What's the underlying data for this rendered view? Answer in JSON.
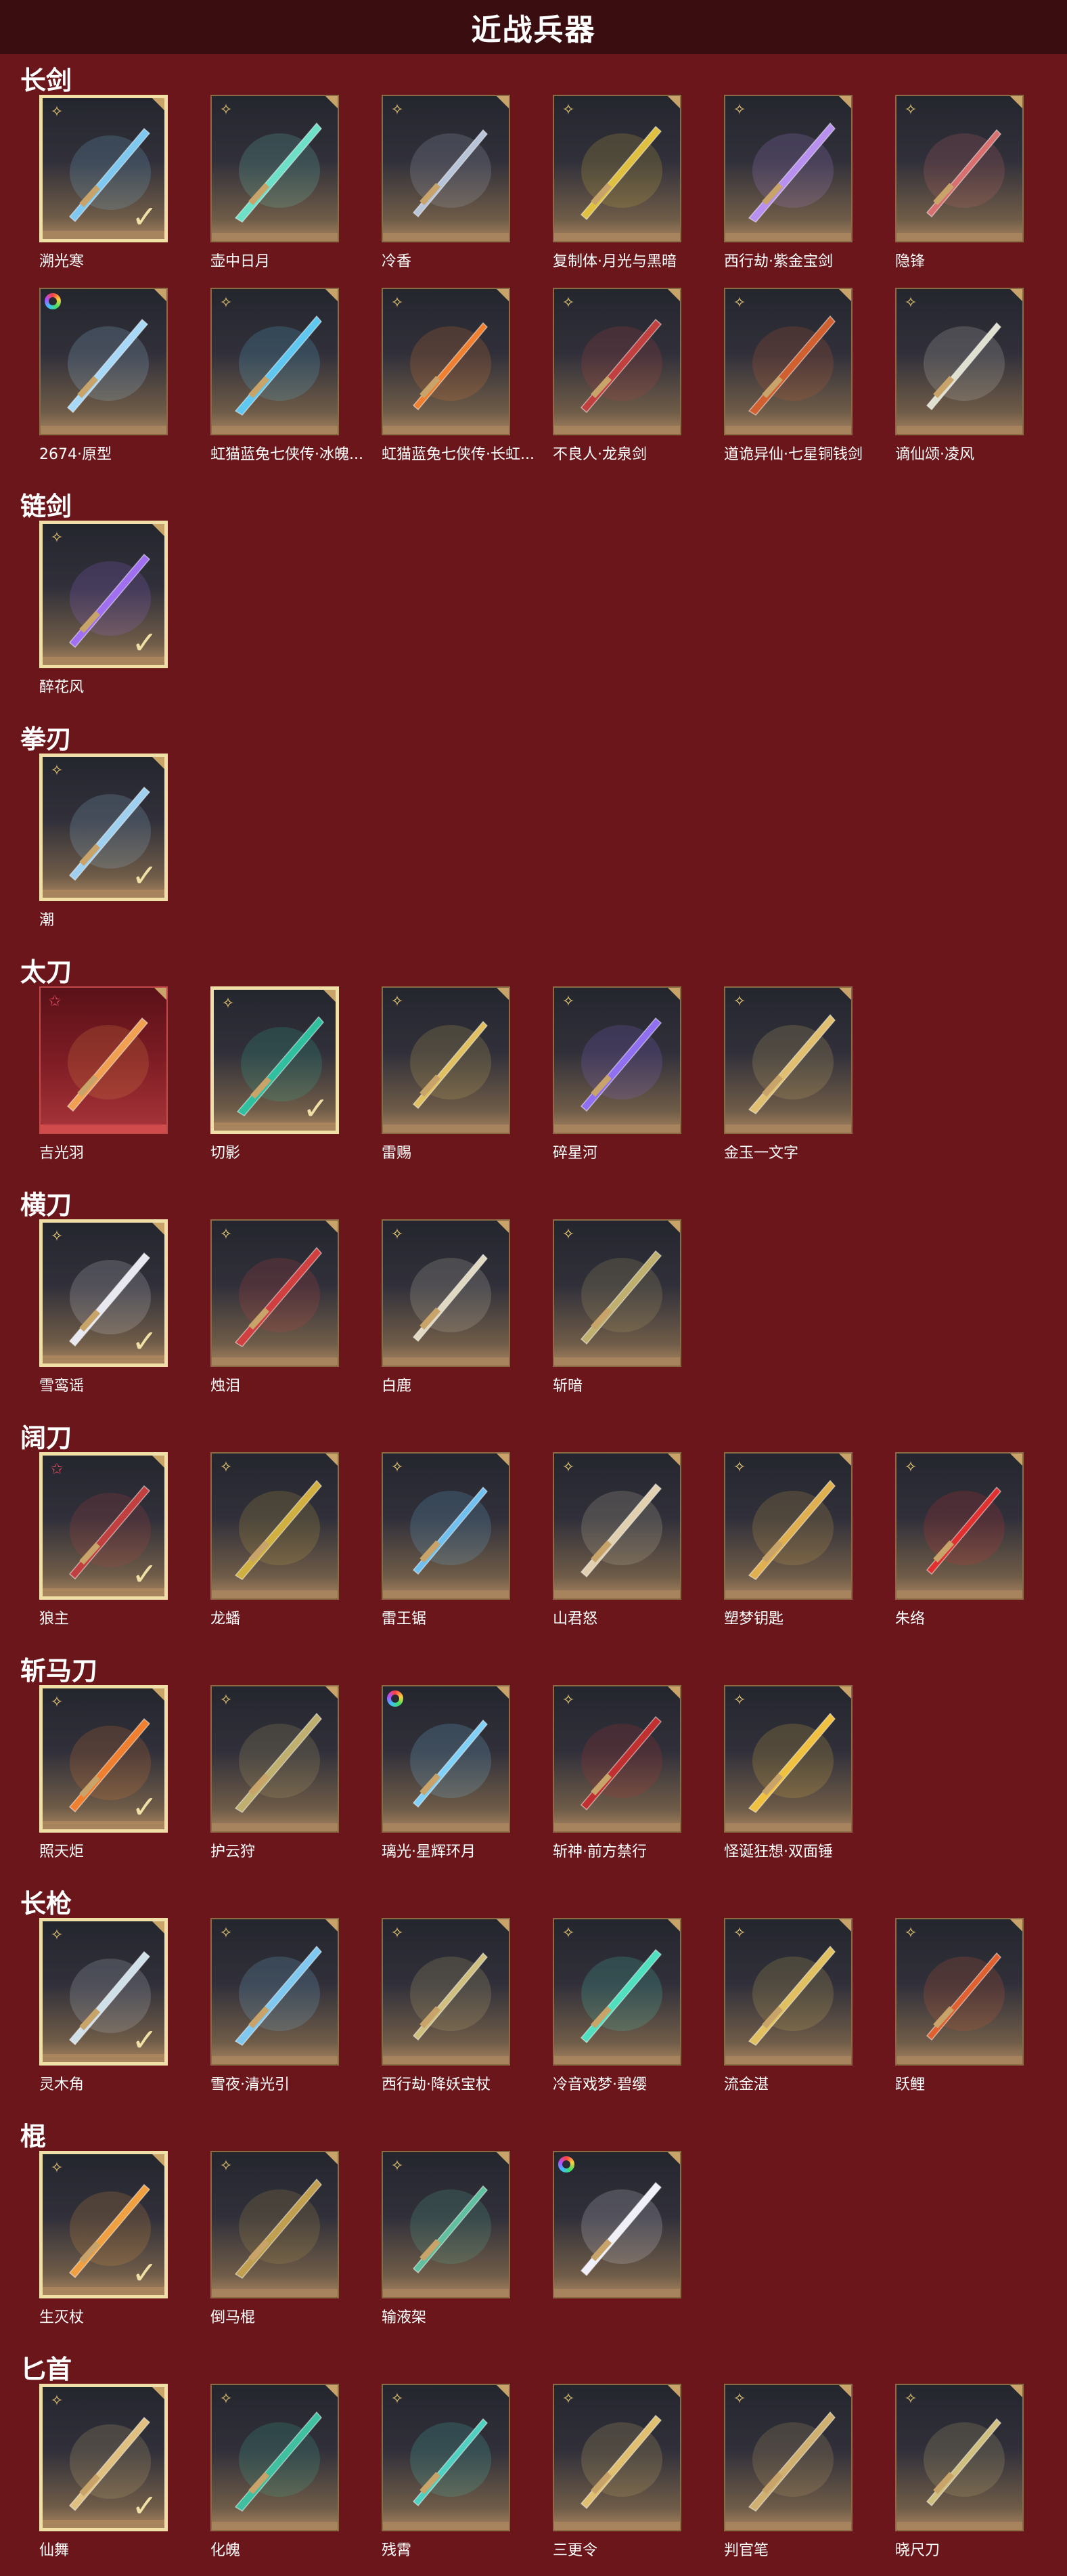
{
  "header": {
    "title": "近战兵器"
  },
  "categories": [
    {
      "title": "长剑",
      "items": [
        {
          "name": "溯光寒",
          "badge": "gold",
          "selected": true,
          "color": "#7fc8f0"
        },
        {
          "name": "壶中日月",
          "badge": "gold",
          "selected": false,
          "color": "#6fe0c8"
        },
        {
          "name": "冷香",
          "badge": "gold",
          "selected": false,
          "color": "#b8c4d8"
        },
        {
          "name": "复制体·月光与黑暗",
          "badge": "gold",
          "selected": false,
          "color": "#e0c040"
        },
        {
          "name": "西行劫·紫金宝剑",
          "badge": "gold",
          "selected": false,
          "color": "#b890f0"
        },
        {
          "name": "隐锋",
          "badge": "gold",
          "selected": false,
          "color": "#d87070"
        },
        {
          "name": "2674·原型",
          "badge": "rainbow",
          "selected": false,
          "color": "#a8d8f8"
        },
        {
          "name": "虹猫蓝兔七侠传·冰魄...",
          "badge": "gold",
          "selected": false,
          "color": "#60c8f0"
        },
        {
          "name": "虹猫蓝兔七侠传·长虹...",
          "badge": "gold",
          "selected": false,
          "color": "#f08030"
        },
        {
          "name": "不良人·龙泉剑",
          "badge": "gold",
          "selected": false,
          "color": "#c04040"
        },
        {
          "name": "道诡异仙·七星铜钱剑",
          "badge": "gold",
          "selected": false,
          "color": "#d06030"
        },
        {
          "name": "谪仙颂·凌风",
          "badge": "gold",
          "selected": false,
          "color": "#e0e0d0"
        }
      ]
    },
    {
      "title": "链剑",
      "items": [
        {
          "name": "醉花风",
          "badge": "gold",
          "selected": true,
          "color": "#a070f0"
        }
      ]
    },
    {
      "title": "拳刃",
      "items": [
        {
          "name": "潮",
          "badge": "gold",
          "selected": true,
          "color": "#a0d0f0"
        }
      ]
    },
    {
      "title": "太刀",
      "items": [
        {
          "name": "吉光羽",
          "badge": "star",
          "selected": false,
          "color": "#f0a050",
          "red": true
        },
        {
          "name": "切影",
          "badge": "gold",
          "selected": true,
          "color": "#30c0a0"
        },
        {
          "name": "雷赐",
          "badge": "gold",
          "selected": false,
          "color": "#e0c060"
        },
        {
          "name": "碎星河",
          "badge": "gold",
          "selected": false,
          "color": "#9070f0"
        },
        {
          "name": "金玉一文字",
          "badge": "gold",
          "selected": false,
          "color": "#e0c070"
        }
      ]
    },
    {
      "title": "横刀",
      "items": [
        {
          "name": "雪鸾谣",
          "badge": "gold",
          "selected": true,
          "color": "#e8e8f0"
        },
        {
          "name": "烛泪",
          "badge": "gold",
          "selected": false,
          "color": "#d04040"
        },
        {
          "name": "白鹿",
          "badge": "gold",
          "selected": false,
          "color": "#e0d8c0"
        },
        {
          "name": "斩暗",
          "badge": "gold",
          "selected": false,
          "color": "#c0b070"
        }
      ]
    },
    {
      "title": "阔刀",
      "items": [
        {
          "name": "狼主",
          "badge": "star",
          "selected": true,
          "color": "#c04040"
        },
        {
          "name": "龙蟠",
          "badge": "gold",
          "selected": false,
          "color": "#d0b040"
        },
        {
          "name": "雷王锯",
          "badge": "gold",
          "selected": false,
          "color": "#70c0f0"
        },
        {
          "name": "山君怒",
          "badge": "gold",
          "selected": false,
          "color": "#e0d0b0"
        },
        {
          "name": "塑梦钥匙",
          "badge": "gold",
          "selected": false,
          "color": "#e0b050"
        },
        {
          "name": "朱络",
          "badge": "gold",
          "selected": false,
          "color": "#e03030"
        }
      ]
    },
    {
      "title": "斩马刀",
      "items": [
        {
          "name": "照天炬",
          "badge": "gold",
          "selected": true,
          "color": "#f08030"
        },
        {
          "name": "护云狩",
          "badge": "gold",
          "selected": false,
          "color": "#c0b070"
        },
        {
          "name": "璃光·星辉环月",
          "badge": "rainbow",
          "selected": false,
          "color": "#80d0f8"
        },
        {
          "name": "斩神·前方禁行",
          "badge": "gold",
          "selected": false,
          "color": "#c03030"
        },
        {
          "name": "怪诞狂想·双面锤",
          "badge": "gold",
          "selected": false,
          "color": "#f0c040"
        }
      ]
    },
    {
      "title": "长枪",
      "items": [
        {
          "name": "灵木角",
          "badge": "gold",
          "selected": true,
          "color": "#d0e0e8"
        },
        {
          "name": "雪夜·清光引",
          "badge": "gold",
          "selected": false,
          "color": "#80c8f0"
        },
        {
          "name": "西行劫·降妖宝杖",
          "badge": "gold",
          "selected": false,
          "color": "#d0c080"
        },
        {
          "name": "冷音戏梦·碧缨",
          "badge": "gold",
          "selected": false,
          "color": "#50e0c0"
        },
        {
          "name": "流金湛",
          "badge": "gold",
          "selected": false,
          "color": "#e0c060"
        },
        {
          "name": "跃鲤",
          "badge": "gold",
          "selected": false,
          "color": "#e06030"
        }
      ]
    },
    {
      "title": "棍",
      "items": [
        {
          "name": "生灭杖",
          "badge": "gold",
          "selected": true,
          "color": "#f0a040"
        },
        {
          "name": "倒马棍",
          "badge": "gold",
          "selected": false,
          "color": "#c0a050"
        },
        {
          "name": "输液架",
          "badge": "gold",
          "selected": false,
          "color": "#60c0a0"
        },
        {
          "name": "",
          "badge": "rainbow",
          "selected": false,
          "color": "#f0f0f8"
        }
      ]
    },
    {
      "title": "匕首",
      "items": [
        {
          "name": "仙舞",
          "badge": "gold",
          "selected": true,
          "color": "#e0c080"
        },
        {
          "name": "化魄",
          "badge": "gold",
          "selected": false,
          "color": "#40c0a0"
        },
        {
          "name": "残霄",
          "badge": "gold",
          "selected": false,
          "color": "#50d0c0"
        },
        {
          "name": "三更令",
          "badge": "gold",
          "selected": false,
          "color": "#e0c070"
        },
        {
          "name": "判官笔",
          "badge": "gold",
          "selected": false,
          "color": "#d0b070"
        },
        {
          "name": "晓尺刀",
          "badge": "gold",
          "selected": false,
          "color": "#d0c080"
        }
      ]
    }
  ]
}
